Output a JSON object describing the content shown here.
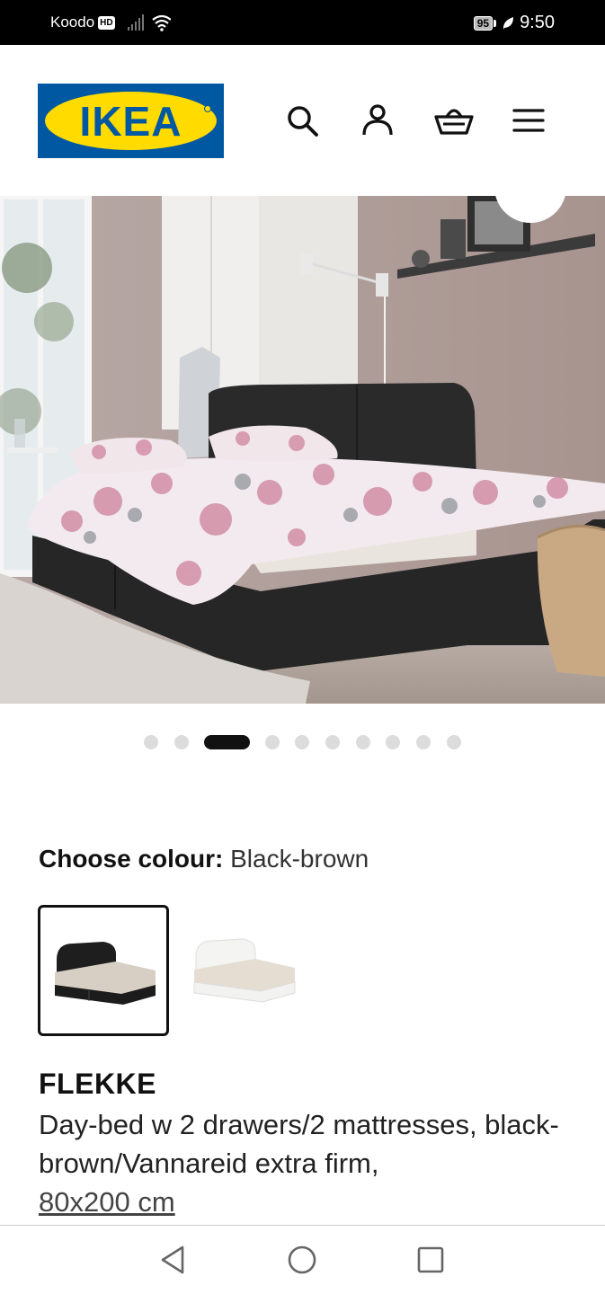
{
  "status_bar": {
    "carrier": "Koodo",
    "hd_badge": "HD",
    "battery": "95",
    "time": "9:50"
  },
  "header": {
    "logo_text": "IKEA",
    "icons": [
      "search-icon",
      "account-icon",
      "shopping-basket-icon",
      "menu-icon"
    ],
    "brand_blue": "#0058a3",
    "brand_yellow": "#ffdb00"
  },
  "gallery": {
    "image_count": 10,
    "active_index": 2
  },
  "colour": {
    "label": "Choose colour:",
    "value": "Black-brown",
    "options": [
      "Black-brown",
      "White"
    ]
  },
  "product": {
    "name": "FLEKKE",
    "description": "Day-bed w 2 drawers/2 mattresses, black-brown/Vannareid extra firm,",
    "size": "80x200 cm"
  },
  "system_nav": {
    "icons": [
      "back-icon",
      "home-icon",
      "recents-icon"
    ]
  }
}
